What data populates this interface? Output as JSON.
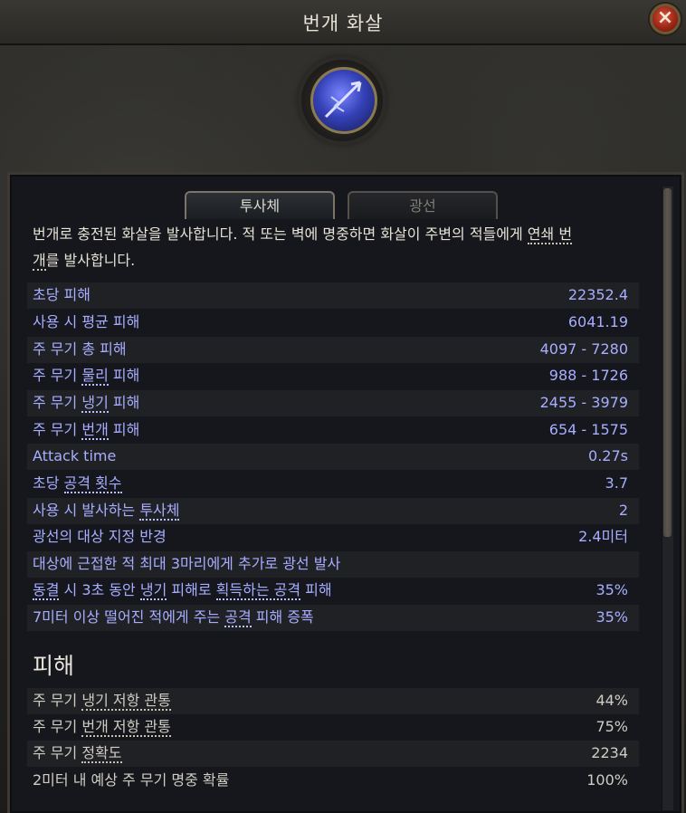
{
  "window": {
    "title": "번개 화살"
  },
  "tabs": [
    {
      "label": "투사체"
    },
    {
      "label": "광선"
    }
  ],
  "description": {
    "part1": "번개로 충전된 화살을 발사합니다. 적 또는 벽에 명중하면 화살이 주변의 적들에게 ",
    "link1a": "연쇄 번",
    "link1b": "개",
    "part2": "를 발사합니다."
  },
  "stats": [
    {
      "label": "초당 피해",
      "value": "22352.4"
    },
    {
      "label": "사용 시 평균 피해",
      "value": "6041.19"
    },
    {
      "label": "주 무기 총 피해",
      "value": "4097 - 7280"
    },
    {
      "pre": "주 무기 ",
      "key": "물리",
      "post": " 피해",
      "value": "988 - 1726"
    },
    {
      "pre": "주 무기 ",
      "key": "냉기",
      "post": " 피해",
      "value": "2455 - 3979"
    },
    {
      "pre": "주 무기 ",
      "key": "번개",
      "post": " 피해",
      "value": "654 - 1575"
    },
    {
      "label": "Attack time",
      "value": "0.27s"
    },
    {
      "pre": "초당 ",
      "key": "공격 횟수",
      "post": "",
      "value": "3.7"
    },
    {
      "pre": "사용 시 발사하는 ",
      "key": "투사체",
      "post": "",
      "value": "2"
    },
    {
      "label": "광선의 대상 지정 반경",
      "value": "2.4미터"
    },
    {
      "label": "대상에 근접한 적 최대 3마리에게 추가로 광선 발사",
      "value": ""
    },
    {
      "key": "동결",
      "mid1": " 시 3초 동안 ",
      "key2": "냉기",
      "mid2": " 피해로 ",
      "key3": "획득하는 공격",
      "post": " 피해",
      "value": "35%"
    },
    {
      "pre": "7미터 이상 떨어진 적에게 주는 ",
      "key": "공격",
      "post": " 피해 증폭",
      "value": "35%"
    }
  ],
  "damage_section": {
    "title": "피해",
    "rows": [
      {
        "pre": "주 무기 ",
        "key": "냉기 저항 관통",
        "value": "44%"
      },
      {
        "pre": "주 무기 ",
        "key": "번개 저항 관통",
        "value": "75%"
      },
      {
        "pre": "주 무기 ",
        "key": "정확도",
        "value": "2234"
      },
      {
        "pre": "2미터 내 예상 주 무기 명중 확률",
        "key": "",
        "value": "100%"
      }
    ]
  },
  "icons": {
    "close": "close-icon",
    "skill": "lightning-arrow-skill-icon"
  },
  "colors": {
    "stat_text": "#a8aeff",
    "body_text": "#e6e2d6",
    "close_red": "#b9301c"
  }
}
